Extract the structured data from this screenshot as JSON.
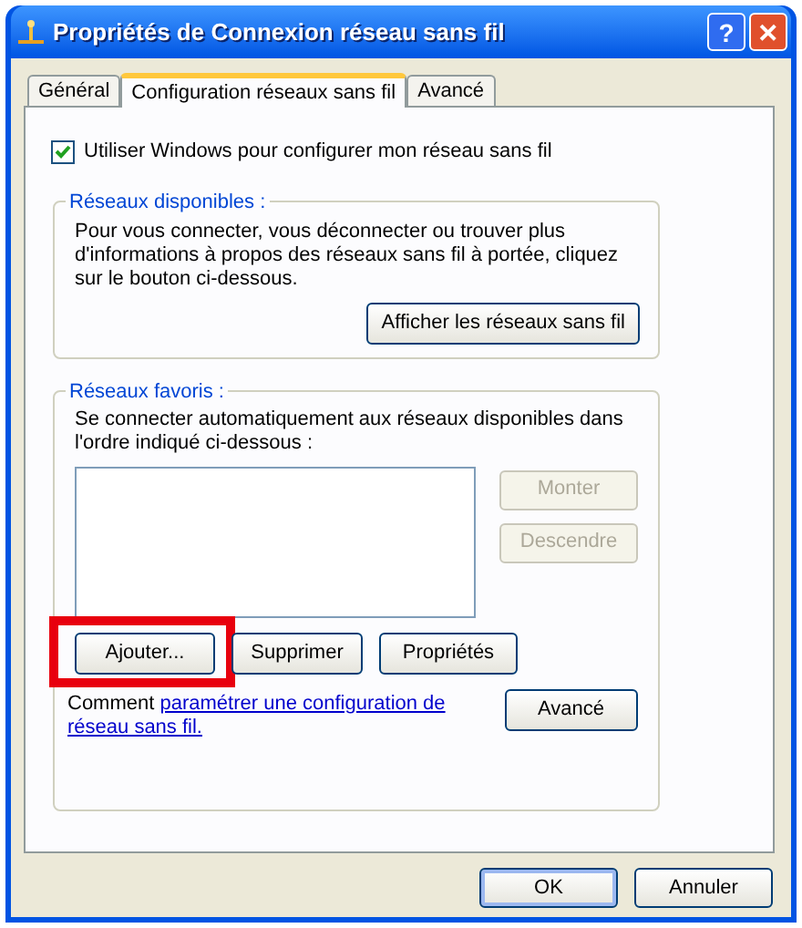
{
  "window": {
    "title": "Propriétés de Connexion réseau sans fil"
  },
  "title_buttons": [
    {
      "kind": "help",
      "label": "?"
    },
    {
      "kind": "close",
      "label": "✕"
    }
  ],
  "tabs": [
    {
      "label": "Général",
      "selected": false
    },
    {
      "label": "Configuration réseaux sans fil",
      "selected": true
    },
    {
      "label": "Avancé",
      "selected": false
    }
  ],
  "use_windows": {
    "label": "Utiliser Windows pour configurer mon réseau sans fil",
    "checked": true
  },
  "available": {
    "legend": "Réseaux disponibles :",
    "text": "Pour vous connecter, vous déconnecter ou trouver plus d'informations à propos des réseaux sans fil à portée, cliquez sur le bouton ci-dessous.",
    "button": "Afficher les réseaux sans fil"
  },
  "preferred": {
    "legend": "Réseaux favoris :",
    "text": "Se connecter automatiquement aux réseaux disponibles dans l'ordre indiqué ci-dessous :",
    "side_buttons": [
      {
        "label": "Monter",
        "disabled": true
      },
      {
        "label": "Descendre",
        "disabled": true
      }
    ],
    "buttons": [
      {
        "label": "Ajouter...",
        "highlighted": true
      },
      {
        "label": "Supprimer",
        "highlighted": false
      },
      {
        "label": "Propriétés",
        "highlighted": false
      }
    ],
    "help": {
      "prefix": "Comment",
      "link_lines": [
        "paramétrer une configuration de",
        "réseau sans fil."
      ]
    },
    "advanced_button": "Avancé"
  },
  "buttons": [
    {
      "label": "OK",
      "default": true
    },
    {
      "label": "Annuler",
      "default": false
    }
  ]
}
